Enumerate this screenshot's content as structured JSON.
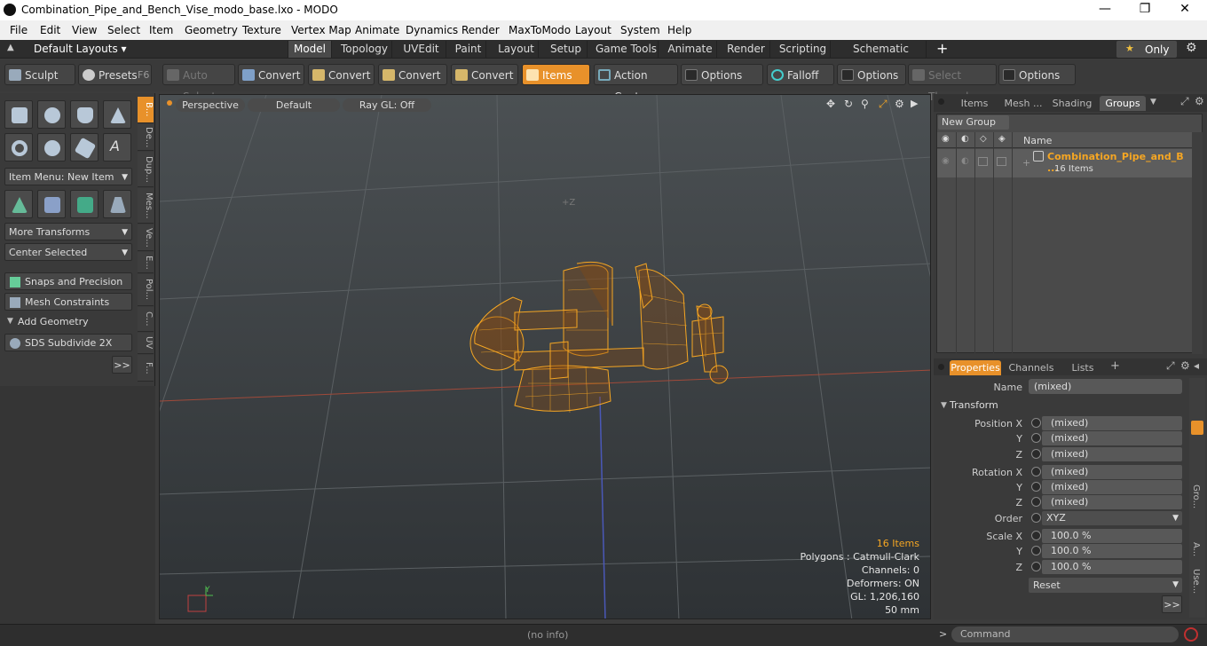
{
  "window": {
    "title": "Combination_Pipe_and_Bench_Vise_modo_base.lxo - MODO",
    "minimize": "—",
    "maximize": "❐",
    "close": "✕"
  },
  "menu": [
    "File",
    "Edit",
    "View",
    "Select",
    "Item",
    "Geometry",
    "Texture",
    "Vertex Map",
    "Animate",
    "Dynamics",
    "Render",
    "MaxToModo",
    "Layout",
    "System",
    "Help"
  ],
  "layoutbar": {
    "default_layouts": "Default Layouts ▾",
    "tabs": [
      "Model",
      "Topology",
      "UVEdit",
      "Paint",
      "Layout",
      "Setup",
      "Game Tools",
      "Animate",
      "Render",
      "Scripting",
      "Schematic Fusion"
    ],
    "active_tab": "Model",
    "add": "+",
    "only": "Only",
    "star": "★"
  },
  "toolbar": {
    "sculpt": "Sculpt",
    "presets": "Presets",
    "presets_key": "F6",
    "auto_select": "Auto Select",
    "convert": "Convert",
    "items": "Items",
    "action_center": "Action Center",
    "options": "Options",
    "falloff": "Falloff",
    "select_through": "Select Through"
  },
  "leftpanel": {
    "item_menu": "Item Menu: New Item",
    "more_transforms": "More Transforms",
    "center_selected": "Center Selected",
    "snaps": "Snaps and Precision",
    "mesh_constraints": "Mesh Constraints",
    "add_geometry": "Add Geometry",
    "sds": "SDS Subdivide 2X",
    "more": ">>",
    "vtabs": [
      "B...",
      "De...",
      "Dup...",
      "Mes...",
      "Ve...",
      "E...",
      "Pol...",
      "C...",
      "UV",
      "F..."
    ]
  },
  "viewport": {
    "perspective": "Perspective",
    "default": "Default",
    "raygl": "Ray GL: Off",
    "axis_z_label": "+Z",
    "items_count": "16 Items",
    "polygons": "Polygons : Catmull-Clark",
    "channels": "Channels: 0",
    "deformers": "Deformers: ON",
    "gl": "GL: 1,206,160",
    "scale": "50 mm",
    "axis_x": "X",
    "axis_y": "Y"
  },
  "groups": {
    "tabs": [
      "Items",
      "Mesh ...",
      "Shading",
      "Groups"
    ],
    "active_tab": "Groups",
    "new_group": "New Group",
    "name_header": "Name",
    "group_name": "Combination_Pipe_and_B ...",
    "group_count": "16 Items"
  },
  "properties": {
    "tabs": [
      "Properties",
      "Channels",
      "Lists"
    ],
    "name_label": "Name",
    "name_value": "(mixed)",
    "transform": "Transform",
    "position_x": "Position X",
    "rotation_x": "Rotation X",
    "y": "Y",
    "z": "Z",
    "mixed": "(mixed)",
    "order_label": "Order",
    "order_value": "XYZ",
    "scale_x": "Scale X",
    "scale_value": "100.0 %",
    "reset": "Reset",
    "more": ">>",
    "side_tabs": [
      "Gro...",
      "A...",
      "Use..."
    ]
  },
  "statusbar": {
    "info": "(no info)",
    "prompt": ">",
    "command": "Command"
  },
  "colors": {
    "accent": "#e8912a",
    "wire": "#f5a623"
  }
}
